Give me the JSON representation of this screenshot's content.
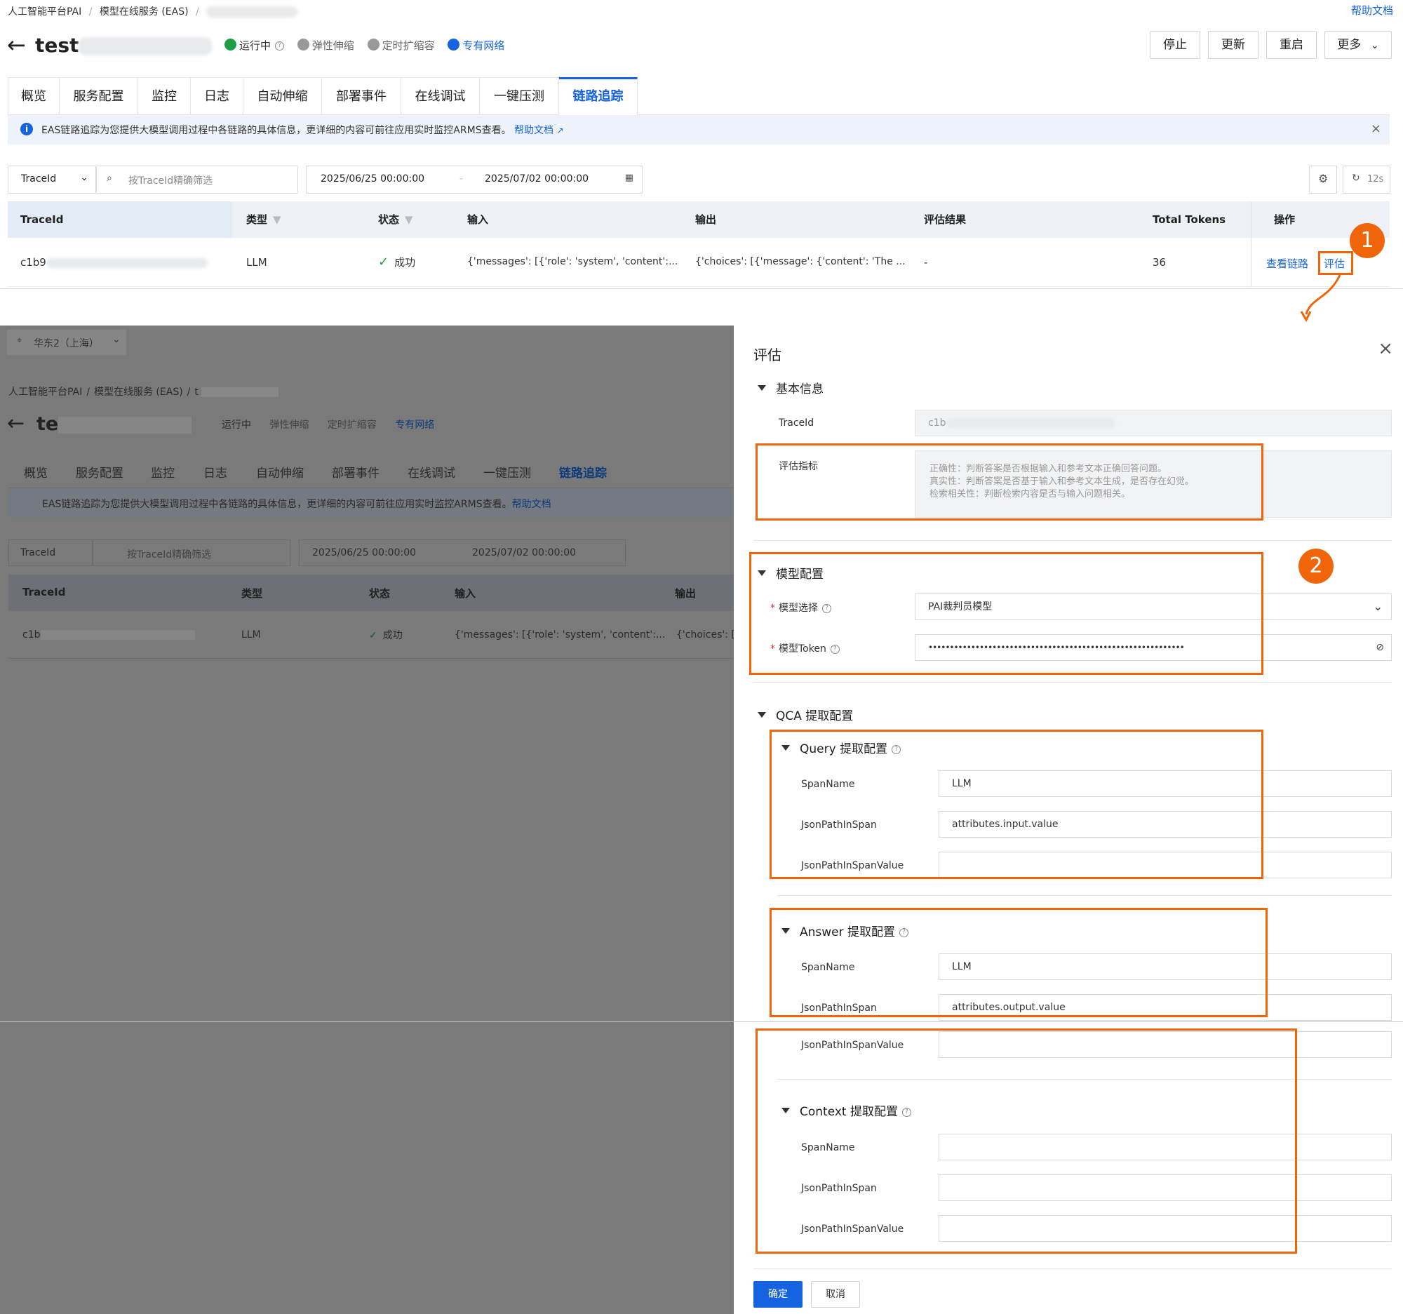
{
  "top": {
    "breadcrumb": [
      "人工智能平台PAI",
      "/",
      "模型在线服务 (EAS)",
      "/"
    ],
    "help_link": "帮助文档",
    "service_name_prefix": "test",
    "status": {
      "running": "运行中",
      "elastic": "弹性伸缩",
      "scheduled": "定时扩缩容",
      "vpc": "专有网络"
    },
    "buttons": {
      "stop": "停止",
      "update": "更新",
      "restart": "重启",
      "more": "更多"
    },
    "tabs": [
      "概览",
      "服务配置",
      "监控",
      "日志",
      "自动伸缩",
      "部署事件",
      "在线调试",
      "一键压测",
      "链路追踪"
    ],
    "active_tab": "链路追踪",
    "notice": {
      "text": "EAS链路追踪为您提供大模型调用过程中各链路的具体信息，更详细的内容可前往应用实时监控ARMS查看。",
      "link": "帮助文档"
    },
    "filter": {
      "select": "TraceId",
      "placeholder": "按TraceId精确筛选",
      "date_start": "2025/06/25 00:00:00",
      "date_end": "2025/07/02 00:00:00",
      "refresh": "12s"
    },
    "table": {
      "headers": {
        "traceid": "TraceId",
        "type": "类型",
        "status": "状态",
        "input": "输入",
        "output": "输出",
        "eval": "评估结果",
        "tokens": "Total Tokens",
        "ops": "操作"
      },
      "row": {
        "traceid": "c1b9",
        "type": "LLM",
        "status": "成功",
        "input": "{'messages': [{'role': 'system', 'content':...",
        "output": "{'choices': [{'message': {'content': 'The ...",
        "eval": "-",
        "tokens": "36",
        "op_view": "查看链路",
        "op_eval": "评估"
      }
    }
  },
  "badges": {
    "one": "1",
    "two": "2"
  },
  "bg": {
    "region": "华东2（上海）",
    "breadcrumb": [
      "人工智能平台PAI",
      "/",
      "模型在线服务 (EAS)",
      "/",
      "t"
    ],
    "service_name_prefix": "te",
    "row_traceid": "c1b",
    "row_output": "{'choices': [{'",
    "output_header": "输出"
  },
  "drawer": {
    "title": "评估",
    "basic": {
      "title": "基本信息",
      "traceid_label": "TraceId",
      "traceid_value": "c1b",
      "metric_label": "评估指标",
      "metric_lines": [
        "正确性：判断答案是否根据输入和参考文本正确回答问题。",
        "真实性：判断答案是否基于输入和参考文本生成，是否存在幻觉。",
        "检索相关性：判断检索内容是否与输入问题相关。"
      ]
    },
    "model": {
      "title": "模型配置",
      "select_label": "模型选择",
      "select_value": "PAI裁判员模型",
      "token_label": "模型Token",
      "token_value": "••••••••••••••••••••••••••••••••••••••••••••••••••••••••••••"
    },
    "qca": {
      "title": "QCA 提取配置",
      "query": {
        "title": "Query 提取配置",
        "span_label": "SpanName",
        "span_value": "LLM",
        "path_label": "JsonPathInSpan",
        "path_value": "attributes.input.value",
        "pathv_label": "JsonPathInSpanValue",
        "pathv_value": ""
      },
      "answer": {
        "title": "Answer 提取配置",
        "span_label": "SpanName",
        "span_value": "LLM",
        "path_label": "JsonPathInSpan",
        "path_value": "attributes.output.value",
        "pathv_label": "JsonPathInSpanValue",
        "pathv_value": ""
      },
      "context": {
        "title": "Context 提取配置",
        "span_label": "SpanName",
        "span_value": "",
        "path_label": "JsonPathInSpan",
        "path_value": "",
        "pathv_label": "JsonPathInSpanValue",
        "pathv_value": ""
      }
    },
    "footer": {
      "confirm": "确定",
      "cancel": "取消"
    }
  },
  "colors": {
    "accent": "#1563e0",
    "highlight": "#f0650a",
    "success": "#1e9e45",
    "notice_bg": "#eef3fb"
  }
}
